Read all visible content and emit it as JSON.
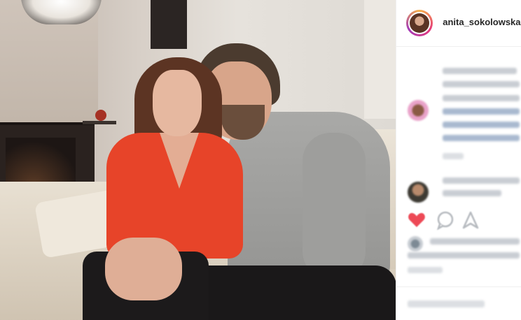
{
  "post": {
    "username": "anita_sokolowska",
    "photo_alt": "couple on sofa"
  },
  "icons": {
    "like": "heart-icon",
    "comment": "comment-icon",
    "share": "share-icon"
  },
  "colors": {
    "like": "#ed4956",
    "link": "#003569",
    "text": "#262626"
  }
}
